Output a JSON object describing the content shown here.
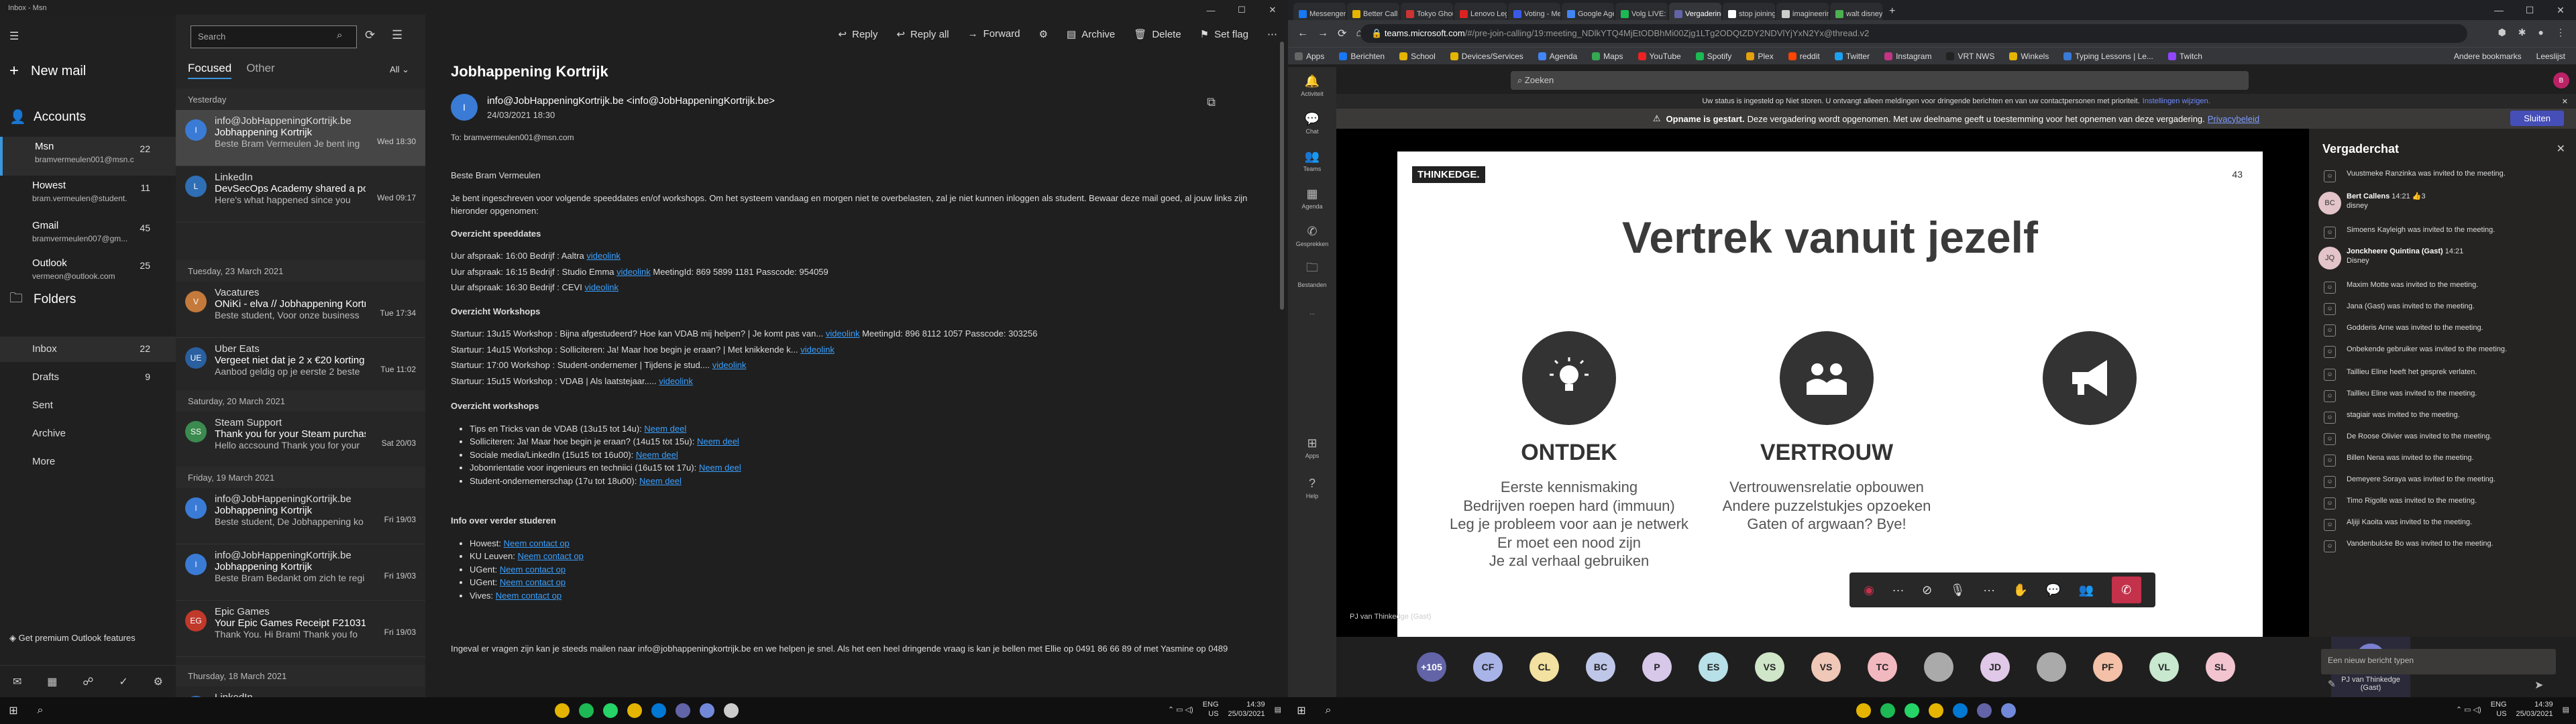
{
  "mail": {
    "window_title": "Inbox - Msn",
    "new_mail": "New mail",
    "accounts_header": "Accounts",
    "accounts": [
      {
        "name": "Msn",
        "email": "bramvermeulen001@msn.c",
        "count": "22"
      },
      {
        "name": "Howest",
        "email": "bram.vermeulen@student.",
        "count": "11"
      },
      {
        "name": "Gmail",
        "email": "bramvermeulen007@gm...",
        "count": "45"
      },
      {
        "name": "Outlook",
        "email": "vermeon@outlook.com",
        "count": "25"
      }
    ],
    "folders_header": "Folders",
    "folders": [
      {
        "name": "Inbox",
        "count": "22"
      },
      {
        "name": "Drafts",
        "count": "9"
      },
      {
        "name": "Sent",
        "count": ""
      },
      {
        "name": "Archive",
        "count": ""
      },
      {
        "name": "More",
        "count": ""
      }
    ],
    "premium": "Get premium Outlook features",
    "search_placeholder": "Search",
    "tab_focused": "Focused",
    "tab_other": "Other",
    "filter_all": "All",
    "dates": [
      "Yesterday",
      "Tuesday, 23 March 2021",
      "Saturday, 20 March 2021",
      "Friday, 19 March 2021",
      "Thursday, 18 March 2021"
    ],
    "messages": [
      {
        "initial": "I",
        "color": "#3a7bd5",
        "from": "info@JobHappeningKortrijk.be",
        "subject": "Jobhappening Kortrijk",
        "preview": "Beste Bram Vermeulen Je bent ing",
        "time": "Wed 18:30"
      },
      {
        "initial": "L",
        "color": "#2f6fb5",
        "from": "LinkedIn",
        "subject": "DevSecOps Academy shared a pos",
        "preview": "Here's what happened since you",
        "time": "Wed 09:17"
      },
      {
        "initial": "V",
        "color": "#c47a3a",
        "from": "Vacatures",
        "subject": "ONiKi - elva // Jobhappening Kortr",
        "preview": "Beste student, Voor onze business",
        "time": "Tue 17:34"
      },
      {
        "initial": "UE",
        "color": "#2a5fa0",
        "from": "Uber Eats",
        "subject": "Vergeet niet dat je 2 x €20 korting",
        "preview": "Aanbod geldig op je eerste 2 beste",
        "time": "Tue 11:02"
      },
      {
        "initial": "SS",
        "color": "#3b8a4f",
        "from": "Steam Support",
        "subject": "Thank you for your Steam purchas",
        "preview": "Hello accsound Thank you for your",
        "time": "Sat 20/03"
      },
      {
        "initial": "I",
        "color": "#3a7bd5",
        "from": "info@JobHappeningKortrijk.be",
        "subject": "Jobhappening Kortrijk",
        "preview": "Beste student, De Jobhappening ko",
        "time": "Fri 19/03"
      },
      {
        "initial": "I",
        "color": "#3a7bd5",
        "from": "info@JobHappeningKortrijk.be",
        "subject": "Jobhappening Kortrijk",
        "preview": "Beste Bram Bedankt om zich te regi",
        "time": "Fri 19/03"
      },
      {
        "initial": "EG",
        "color": "#c0392b",
        "from": "Epic Games",
        "subject": "Your Epic Games Receipt F21031907",
        "preview": "Thank You. Hi Bram! Thank you fo",
        "time": "Fri 19/03"
      },
      {
        "initial": "L",
        "color": "#2f6fb5",
        "from": "LinkedIn",
        "subject": "",
        "preview": "",
        "time": ""
      }
    ],
    "toolbar": [
      "Reply",
      "Reply all",
      "Forward",
      "Archive",
      "Delete",
      "Set flag"
    ],
    "read": {
      "subject": "Jobhappening Kortrijk",
      "avatar": "I",
      "from": "info@JobHappeningKortrijk.be <info@JobHappeningKortrijk.be>",
      "when": "24/03/2021 18:30",
      "to": "To: bramvermeulen001@msn.com",
      "greeting": "Beste Bram Vermeulen",
      "intro": "Je bent ingeschreven voor volgende speeddates en/of workshops. Om het systeem vandaag en morgen niet te overbelasten, zal je niet kunnen inloggen als student. Bewaar deze mail goed, al jouw links zijn hieronder opgenomen:",
      "speeddates_title": "Overzicht speeddates",
      "speeddates": [
        {
          "text": "Uur afspraak: 16:00 Bedrijf : Aaltra",
          "link": "videolink",
          "extra": ""
        },
        {
          "text": "Uur afspraak: 16:15 Bedrijf : Studio Emma",
          "link": "videolink",
          "extra": "MeetingId: 869 5899 1181 Passcode: 954059"
        },
        {
          "text": "Uur afspraak: 16:30 Bedrijf : CEVI",
          "link": "videolink",
          "extra": ""
        }
      ],
      "workshops_title": "Overzicht Workshops",
      "workshops": [
        {
          "text": "Startuur: 13u15 Workshop : Bijna afgestudeerd? Hoe kan VDAB mij helpen? | Je komt pas van...",
          "link": "videolink",
          "extra": "MeetingId: 896 8112 1057 Passcode: 303256"
        },
        {
          "text": "Startuur: 14u15 Workshop : Solliciteren: Ja! Maar hoe begin je eraan? | Met knikkende k...",
          "link": "videolink",
          "extra": ""
        },
        {
          "text": "Startuur: 17:00  Workshop : Student-ondernemer | Tijdens je stud....",
          "link": "videolink",
          "extra": ""
        },
        {
          "text": "Startuur: 15u15 Workshop : VDAB | Als laatstejaar.....",
          "link": "videolink",
          "extra": ""
        }
      ],
      "overview_title": "Overzicht workshops",
      "overview": [
        {
          "text": "Tips en Tricks van de VDAB (13u15 tot 14u):",
          "link": "Neem deel"
        },
        {
          "text": "Solliciteren: Ja! Maar hoe begin je eraan? (14u15 tot 15u):",
          "link": "Neem deel"
        },
        {
          "text": "Sociale media/LinkedIn (15u15 tot 16u00):",
          "link": "Neem deel"
        },
        {
          "text": "Jobonrientatie voor ingenieurs en techniici (16u15 tot 17u):",
          "link": "Neem deel"
        },
        {
          "text": "Student-ondernemerschap (17u tot 18u00):",
          "link": "Neem deel"
        }
      ],
      "students_title": "Info over verder studeren",
      "students": [
        {
          "text": "Howest:",
          "link": "Neem contact op"
        },
        {
          "text": "KU Leuven:",
          "link": "Neem contact op"
        },
        {
          "text": "UGent:",
          "link": "Neem contact op"
        },
        {
          "text": "UGent:",
          "link": "Neem contact op"
        },
        {
          "text": "Vives:",
          "link": "Neem contact op"
        }
      ],
      "footer": "Ingeval er vragen zijn kan je steeds mailen naar info@jobhappeningkortrijk.be en we helpen je snel. Als het een heel dringende vraag is kan je bellen met Ellie op 0491 86 66 89 of met Yasmine op 0489"
    }
  },
  "taskbar_left": {
    "lang": "ENG",
    "region": "US",
    "time": "14:39",
    "date": "25/03/2021"
  },
  "taskbar_right": {
    "lang": "ENG",
    "region": "US",
    "time": "14:39",
    "date": "25/03/2021"
  },
  "browser": {
    "tabs": [
      {
        "label": "Messenger | Fac",
        "color": "#1877f2"
      },
      {
        "label": "Better Call Saul",
        "color": "#e4b400"
      },
      {
        "label": "Tokyo Ghoul:re",
        "color": "#c33"
      },
      {
        "label": "Lenovo Legion 5",
        "color": "#d22"
      },
      {
        "label": "Voting - Mentim",
        "color": "#3a5ae6"
      },
      {
        "label": "Google Agenda",
        "color": "#4285f4"
      },
      {
        "label": "Volg LIVE: Prem",
        "color": "#1db954"
      },
      {
        "label": "Vergadering",
        "color": "#6264a7"
      },
      {
        "label": "stop joining sou",
        "color": "#fff"
      },
      {
        "label": "imagineering st",
        "color": "#ccc"
      },
      {
        "label": "walt disney wor",
        "color": "#4caf50"
      }
    ],
    "url_host": "teams.microsoft.com",
    "url_path": "/#/pre-join-calling/19:meeting_NDlkYTQ4MjEtODBhMi00Zjg1LTg2ODQtZDY2NDVlYjYxN2Yx@thread.v2",
    "bookmarks": [
      {
        "label": "Apps",
        "color": "#666"
      },
      {
        "label": "Berichten",
        "color": "#1877f2"
      },
      {
        "label": "School",
        "color": "#e4b400"
      },
      {
        "label": "Devices/Services",
        "color": "#e4b400"
      },
      {
        "label": "Agenda",
        "color": "#4285f4"
      },
      {
        "label": "Maps",
        "color": "#34a853"
      },
      {
        "label": "YouTube",
        "color": "#e22"
      },
      {
        "label": "Spotify",
        "color": "#1db954"
      },
      {
        "label": "Plex",
        "color": "#e5a00d"
      },
      {
        "label": "reddit",
        "color": "#ff4500"
      },
      {
        "label": "Twitter",
        "color": "#1da1f2"
      },
      {
        "label": "Instagram",
        "color": "#c13584"
      },
      {
        "label": "VRT NWS",
        "color": "#222"
      },
      {
        "label": "Winkels",
        "color": "#e4b400"
      },
      {
        "label": "Typing Lessons | Le...",
        "color": "#3a7bd5"
      },
      {
        "label": "Twitch",
        "color": "#9146ff"
      }
    ],
    "bookmarks_right": [
      "Andere bookmarks",
      "Leeslijst"
    ]
  },
  "teams": {
    "rail": [
      "Activiteit",
      "Chat",
      "Teams",
      "Agenda",
      "Gesprekken",
      "Bestanden",
      "...",
      "Apps",
      "Help"
    ],
    "search_placeholder": "Zoeken",
    "notice": "Uw status is ingesteld op Niet storen. U ontvangt alleen meldingen voor dringende berichten en van uw contactpersonen met prioriteit.",
    "notice_link": "Instellingen wijzigen.",
    "rec_bold": "Opname is gestart.",
    "rec_text": "Deze vergadering wordt opgenomen. Met uw deelname geeft u toestemming voor het opnemen van deze vergadering.",
    "rec_link": "Privacybeleid",
    "rec_close": "Sluiten",
    "slide": {
      "logo": "THINKEDGE.",
      "page": "43",
      "title": "Vertrek vanuit jezelf",
      "col1_title": "ONTDEK",
      "col1_lines": [
        "Eerste kennismaking",
        "Bedrijven roepen hard (immuun)",
        "Leg je probleem voor aan je netwerk",
        "Er moet een nood zijn",
        "Je zal verhaal gebruiken"
      ],
      "col2_title": "VERTROUW",
      "col2_lines": [
        "Vertrouwensrelatie opbouwen",
        "Andere puzzelstukjes opzoeken",
        "Gaten of argwaan? Bye!"
      ]
    },
    "presenter": "PJ van Thinkedge (Gast)",
    "participants": [
      {
        "label": "+105",
        "color": "#6264a7"
      },
      {
        "label": "CF",
        "color": "#a8b4e8"
      },
      {
        "label": "CL",
        "color": "#f2e1a0"
      },
      {
        "label": "BC",
        "color": "#bfc7e8"
      },
      {
        "label": "P",
        "color": "#d7c8ea"
      },
      {
        "label": "ES",
        "color": "#b7e0e8"
      },
      {
        "label": "VS",
        "color": "#cfe6c8"
      },
      {
        "label": "VS",
        "color": "#f0c8b8"
      },
      {
        "label": "TC",
        "color": "#f2b8c0"
      },
      {
        "label": "",
        "color": "#aaaaaa"
      },
      {
        "label": "JD",
        "color": "#e0c8e8"
      },
      {
        "label": "",
        "color": "#aaaaaa"
      },
      {
        "label": "PF",
        "color": "#f4c0a8"
      },
      {
        "label": "VL",
        "color": "#c8e8d0"
      },
      {
        "label": "SL",
        "color": "#f2c4d0"
      }
    ],
    "speaker_initials": "PT",
    "speaker_name": "PJ van Thinkedge (Gast)",
    "chat_title": "Vergaderchat",
    "chat": [
      {
        "type": "event",
        "text": "Vuustmeke Ranzinka was invited to the meeting."
      },
      {
        "type": "msg",
        "av": "BC",
        "name": "Bert Callens",
        "time": "14:21",
        "extra": "👍3",
        "body": "disney"
      },
      {
        "type": "event",
        "text": "Simoens Kayleigh was invited to the meeting."
      },
      {
        "type": "msg",
        "av": "JQ",
        "name": "Jonckheere Quintina (Gast)",
        "time": "14:21",
        "extra": "",
        "body": "Disney"
      },
      {
        "type": "event",
        "text": "Maxim Motte was invited to the meeting."
      },
      {
        "type": "event",
        "text": "Jana (Gast) was invited to the meeting."
      },
      {
        "type": "event",
        "text": "Godderis Arne was invited to the meeting."
      },
      {
        "type": "event",
        "text": "Onbekende gebruiker was invited to the meeting."
      },
      {
        "type": "event",
        "text": "Taillieu Eline heeft het gesprek verlaten."
      },
      {
        "type": "event",
        "text": "Taillieu Eline was invited to the meeting."
      },
      {
        "type": "event",
        "text": "stagiair was invited to the meeting."
      },
      {
        "type": "event",
        "text": "De Roose Olivier was invited to the meeting."
      },
      {
        "type": "event",
        "text": "Billen Nena was invited to the meeting."
      },
      {
        "type": "event",
        "text": "Demeyere Soraya was invited to the meeting."
      },
      {
        "type": "event",
        "text": "Timo Rigolle was invited to the meeting."
      },
      {
        "type": "event",
        "text": "Aljiji Kaoita was invited to the meeting."
      },
      {
        "type": "event",
        "text": "Vandenbulcke Bo was invited to the meeting."
      }
    ],
    "chat_placeholder": "Een nieuw bericht typen"
  }
}
